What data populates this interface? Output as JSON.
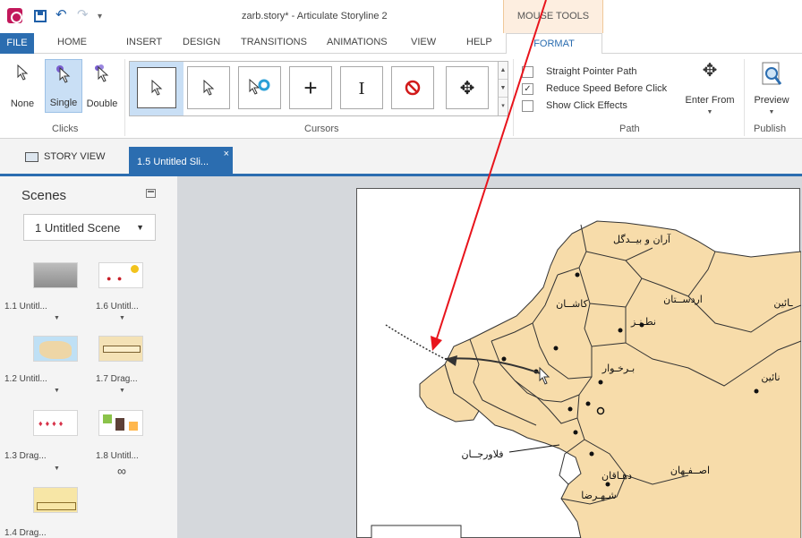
{
  "window": {
    "title": "zarb.story* -  Articulate Storyline 2",
    "contextual_group": "MOUSE TOOLS"
  },
  "tabs": {
    "file": "FILE",
    "home": "HOME",
    "insert": "INSERT",
    "design": "DESIGN",
    "transitions": "TRANSITIONS",
    "animations": "ANIMATIONS",
    "view": "VIEW",
    "help": "HELP",
    "format": "FORMAT"
  },
  "ribbon": {
    "clicks": {
      "group_label": "Clicks",
      "none": "None",
      "single": "Single",
      "double": "Double",
      "selected": "Single"
    },
    "cursors": {
      "group_label": "Cursors",
      "items": [
        "arrow-cursor-icon",
        "arrow-cursor-icon",
        "arrow-ring-cursor-icon",
        "crosshair-cursor-icon",
        "ibeam-cursor-icon",
        "no-entry-cursor-icon",
        "move-cursor-icon"
      ],
      "selected_index": 0
    },
    "path": {
      "group_label": "Path",
      "straight_pointer_path": {
        "label": "Straight Pointer Path",
        "checked": false
      },
      "reduce_speed": {
        "label": "Reduce Speed Before Click",
        "checked": true
      },
      "show_click_effects": {
        "label": "Show Click Effects",
        "checked": false
      },
      "enter_from": "Enter From"
    },
    "publish": {
      "group_label": "Publish",
      "preview": "Preview"
    }
  },
  "doc_tabs": {
    "story_view": "STORY VIEW",
    "active_slide": "1.5 Untitled Sli...",
    "close_glyph": "×"
  },
  "scenes": {
    "title": "Scenes",
    "selected_scene": "1 Untitled Scene",
    "slides": [
      {
        "label": "1.1 Untitl...",
        "marker": "▼"
      },
      {
        "label": "1.6 Untitl...",
        "marker": "▼"
      },
      {
        "label": "1.2 Untitl...",
        "marker": "▼"
      },
      {
        "label": "1.7 Drag...",
        "marker": "▼"
      },
      {
        "label": "1.3 Drag...",
        "marker": "▼"
      },
      {
        "label": "1.8 Untitl...",
        "marker": "link"
      },
      {
        "label": "1.4 Drag...",
        "marker": ""
      }
    ]
  },
  "map": {
    "regions": [
      "آران و بيــدگل",
      "كاشــان",
      "اردســتان",
      "نطـنـز",
      "بـرخـوار",
      "اصــفـهان",
      "دهـاقان",
      "شـهـرضا",
      "فلاورجــان",
      "نائين",
      "ـائين"
    ]
  },
  "colors": {
    "accent": "#2b6db0",
    "contextual": "#fdeee0",
    "map_fill": "#f7dcaa",
    "annotation": "#e8141c"
  }
}
